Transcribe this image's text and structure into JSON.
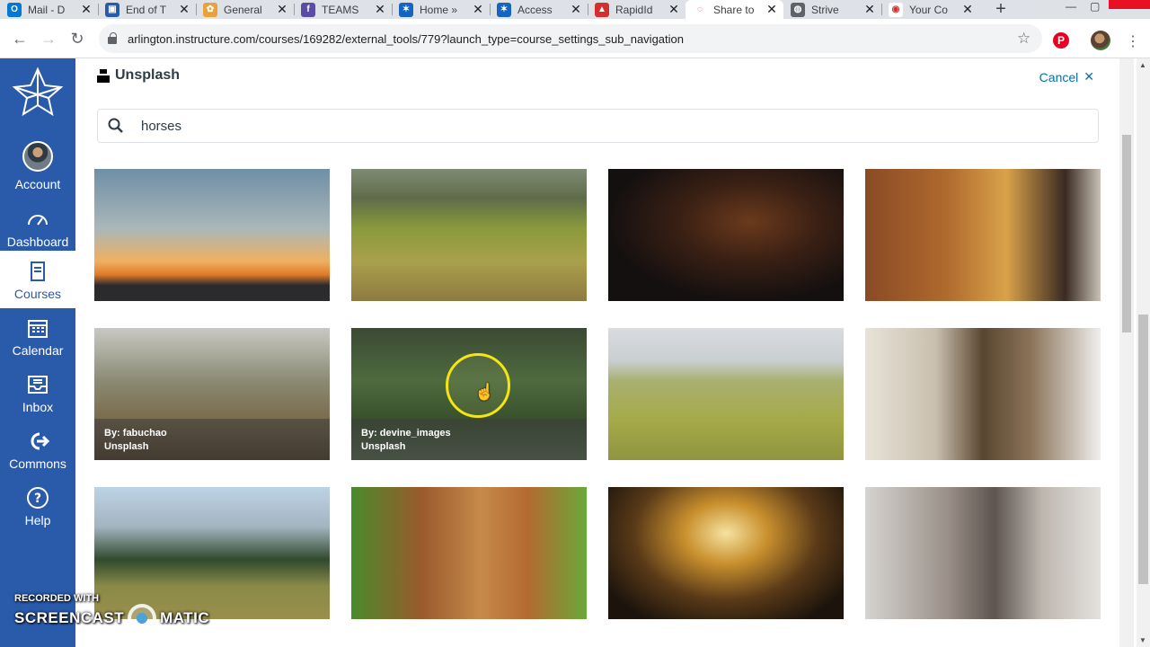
{
  "browser": {
    "tabs": [
      {
        "title": "Mail - D",
        "fav_color": "#0078d4",
        "fav_glyph": "O"
      },
      {
        "title": "End of T",
        "fav_color": "#2a5bab",
        "fav_glyph": "▣"
      },
      {
        "title": "General",
        "fav_color": "#e9a23b",
        "fav_glyph": "✿"
      },
      {
        "title": "TEAMS",
        "fav_color": "#5b4aa6",
        "fav_glyph": "f"
      },
      {
        "title": "Home »",
        "fav_color": "#1565c0",
        "fav_glyph": "✶"
      },
      {
        "title": "Access",
        "fav_color": "#1565c0",
        "fav_glyph": "✶"
      },
      {
        "title": "RapidId",
        "fav_color": "#d32f2f",
        "fav_glyph": "▲"
      },
      {
        "title": "Share to",
        "fav_color": "#ffffff",
        "fav_glyph": "◌"
      },
      {
        "title": "Strive",
        "fav_color": "#5f6368",
        "fav_glyph": "◍"
      },
      {
        "title": "Your Co",
        "fav_color": "#ffffff",
        "fav_glyph": "◉"
      }
    ],
    "url": "arlington.instructure.com/courses/169282/external_tools/779?launch_type=course_settings_sub_navigation"
  },
  "nav": {
    "items": [
      {
        "label": "Account"
      },
      {
        "label": "Dashboard"
      },
      {
        "label": "Courses"
      },
      {
        "label": "Calendar"
      },
      {
        "label": "Inbox"
      },
      {
        "label": "Commons"
      },
      {
        "label": "Help"
      }
    ]
  },
  "tool": {
    "brand": "Unsplash",
    "cancel_label": "Cancel",
    "search_value": "horses"
  },
  "photos": [
    {
      "bg": "linear-gradient(180deg,#6f8fa6 0%,#a9b7b9 45%,#f0b060 70%,#e07a2a 80%,#2b2b2e 88%)",
      "credit_by": "",
      "credit_src": ""
    },
    {
      "bg": "linear-gradient(180deg,#7f8c74 0%,#5e6b4a 22%,#8a9a3c 45%,#a9a04c 70%,#8e7a40 100%)",
      "credit_by": "",
      "credit_src": ""
    },
    {
      "bg": "radial-gradient(ellipse at 60% 40%,#6b3a1c 0%,#3a2014 35%,#151010 70%)",
      "credit_by": "",
      "credit_src": ""
    },
    {
      "bg": "linear-gradient(90deg,#8a4a24 0%,#b06a2e 35%,#d9a24a 60%,#3a2a22 85%,#c9c2b6 100%)",
      "credit_by": "",
      "credit_src": ""
    },
    {
      "bg": "linear-gradient(180deg,#c9c9c4 0%,#8a8a74 40%,#7a6a4a 70%,#4d3a26 100%)",
      "credit_by": "By: fabuchao",
      "credit_src": "Unsplash"
    },
    {
      "bg": "linear-gradient(180deg,#3b4a34 0%,#4e6a3e 40%,#38502c 70%,#566a50 100%)",
      "credit_by": "By: devine_images",
      "credit_src": "Unsplash"
    },
    {
      "bg": "linear-gradient(180deg,#d9dce0 0%,#c9ced0 25%,#a9b070 40%,#a6aa48 70%,#8f9440 100%)",
      "credit_by": "",
      "credit_src": ""
    },
    {
      "bg": "linear-gradient(90deg,#e8e2d8 0%,#c9bfae 30%,#5a4630 50%,#8a7258 70%,#efefee 100%)",
      "credit_by": "",
      "credit_src": ""
    },
    {
      "bg": "linear-gradient(180deg,#bcd3e6 0%,#a4b4c0 30%,#2f4a2c 55%,#8b8a48 75%,#9a8f4c 100%)",
      "credit_by": "",
      "credit_src": ""
    },
    {
      "bg": "linear-gradient(90deg,#4a8a2c 0%,#9a5a2c 30%,#c68a4a 55%,#b46a30 75%,#6aa83a 100%)",
      "credit_by": "",
      "credit_src": ""
    },
    {
      "bg": "radial-gradient(ellipse at 50% 35%,#f6e2a0 0%,#c9902e 25%,#5a3a18 55%,#1c140c 85%)",
      "credit_by": "",
      "credit_src": ""
    },
    {
      "bg": "linear-gradient(90deg,#d6d4d0 0%,#9a9088 35%,#5e5450 55%,#bdb6ae 75%,#e4e2de 100%)",
      "credit_by": "",
      "credit_src": ""
    }
  ],
  "watermark": {
    "line1": "RECORDED WITH",
    "line2a": "SCREENCAST",
    "line2b": "MATIC"
  }
}
